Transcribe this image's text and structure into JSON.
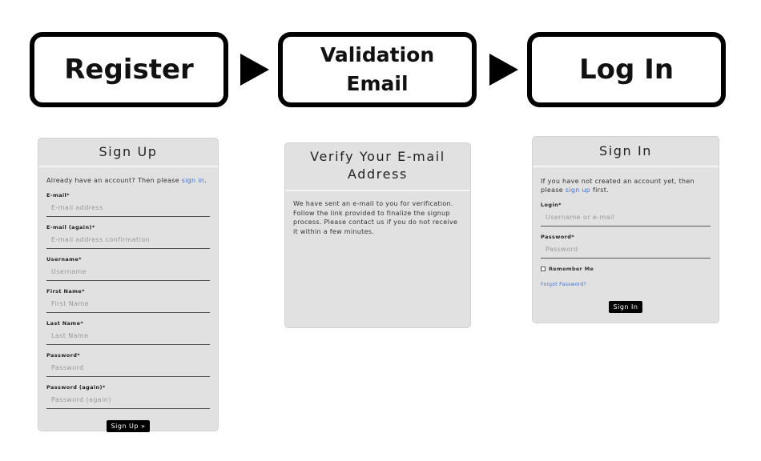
{
  "flow": {
    "steps": [
      "Register",
      "Validation\nEmail",
      "Log In"
    ]
  },
  "signup": {
    "title": "Sign Up",
    "intro_text": "Already have an account? Then please ",
    "intro_link": "sign in",
    "intro_end": ".",
    "fields": [
      {
        "label": "E-mail*",
        "placeholder": "E-mail address"
      },
      {
        "label": "E-mail (again)*",
        "placeholder": "E-mail address confirmation"
      },
      {
        "label": "Username*",
        "placeholder": "Username"
      },
      {
        "label": "First Name*",
        "placeholder": "First Name"
      },
      {
        "label": "Last Name*",
        "placeholder": "Last Name"
      },
      {
        "label": "Password*",
        "placeholder": "Password"
      },
      {
        "label": "Password (again)*",
        "placeholder": "Password (again)"
      }
    ],
    "button": "Sign Up »"
  },
  "verify": {
    "title": "Verify Your E-mail Address",
    "text": "We have sent an e-mail to you for verification. Follow the link provided to finalize the signup process. Please contact us if you do not receive it within a few minutes."
  },
  "signin": {
    "title": "Sign In",
    "intro_text": "If you have not created an account yet, then please ",
    "intro_link": "sign up",
    "intro_end": " first.",
    "fields": [
      {
        "label": "Login*",
        "placeholder": "Username or e-mail"
      },
      {
        "label": "Password*",
        "placeholder": "Password"
      }
    ],
    "remember": "Remember Me",
    "forgot": "Forgot Password?",
    "button": "Sign In"
  }
}
